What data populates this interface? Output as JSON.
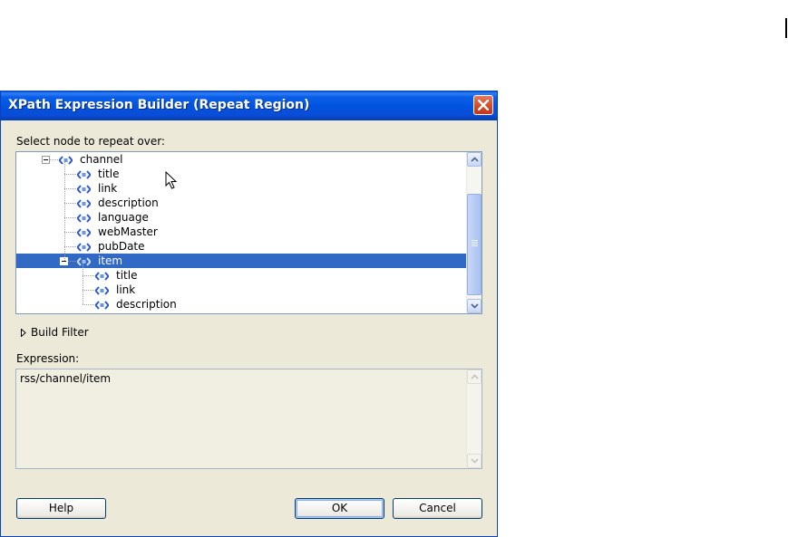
{
  "dialog": {
    "title": "XPath Expression Builder (Repeat Region)",
    "select_label": "Select node to repeat over:",
    "tree": [
      {
        "label": "channel",
        "level": 0,
        "expander": "minus",
        "selected": false
      },
      {
        "label": "title",
        "level": 1,
        "selected": false
      },
      {
        "label": "link",
        "level": 1,
        "selected": false
      },
      {
        "label": "description",
        "level": 1,
        "selected": false
      },
      {
        "label": "language",
        "level": 1,
        "selected": false
      },
      {
        "label": "webMaster",
        "level": 1,
        "selected": false
      },
      {
        "label": "pubDate",
        "level": 1,
        "selected": false
      },
      {
        "label": "item",
        "level": 1,
        "expander": "minus",
        "selected": true
      },
      {
        "label": "title",
        "level": 2,
        "selected": false
      },
      {
        "label": "link",
        "level": 2,
        "selected": false
      },
      {
        "label": "description",
        "level": 2,
        "selected": false
      }
    ],
    "build_filter_label": "Build Filter",
    "expression_label": "Expression:",
    "expression_value": "rss/channel/item",
    "buttons": {
      "help": "Help",
      "ok": "OK",
      "cancel": "Cancel"
    }
  },
  "colors": {
    "titlebar": "#0054e3",
    "selection": "#316ac5",
    "dialog_bg": "#ece9d8",
    "node_icon": "#2a5bd7"
  }
}
